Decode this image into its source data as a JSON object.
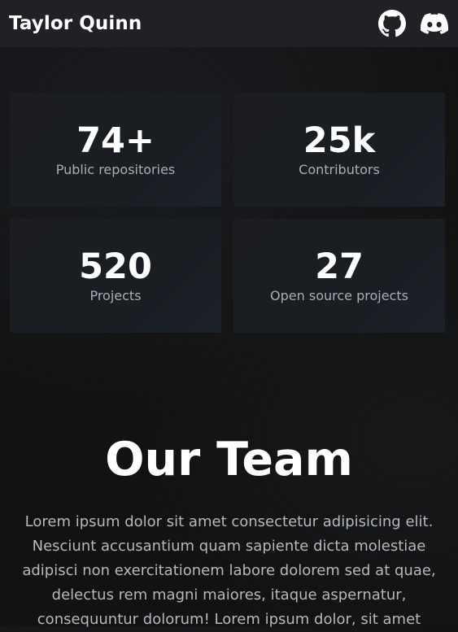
{
  "nav": {
    "brand": "Taylor Quinn",
    "icons": [
      "github-icon",
      "discord-icon"
    ]
  },
  "stats": [
    {
      "value": "74+",
      "label": "Public repositories"
    },
    {
      "value": "25k",
      "label": "Contributors"
    },
    {
      "value": "520",
      "label": "Projects"
    },
    {
      "value": "27",
      "label": "Open source projects"
    }
  ],
  "team": {
    "title": "Our Team",
    "text": "Lorem ipsum dolor sit amet consectetur adipisicing elit. Nesciunt accusantium quam sapiente dicta molestiae adipisci non exercitationem labore dolorem sed at quae, delectus rem magni maiores, itaque aspernatur, consequuntur dolorum! Lorem ipsum dolor, sit amet"
  },
  "colors": {
    "background": "#121212",
    "navbar": "#202124",
    "card": "#1a1c1f",
    "text_primary": "#ffffff",
    "text_muted": "#a9adb5"
  }
}
